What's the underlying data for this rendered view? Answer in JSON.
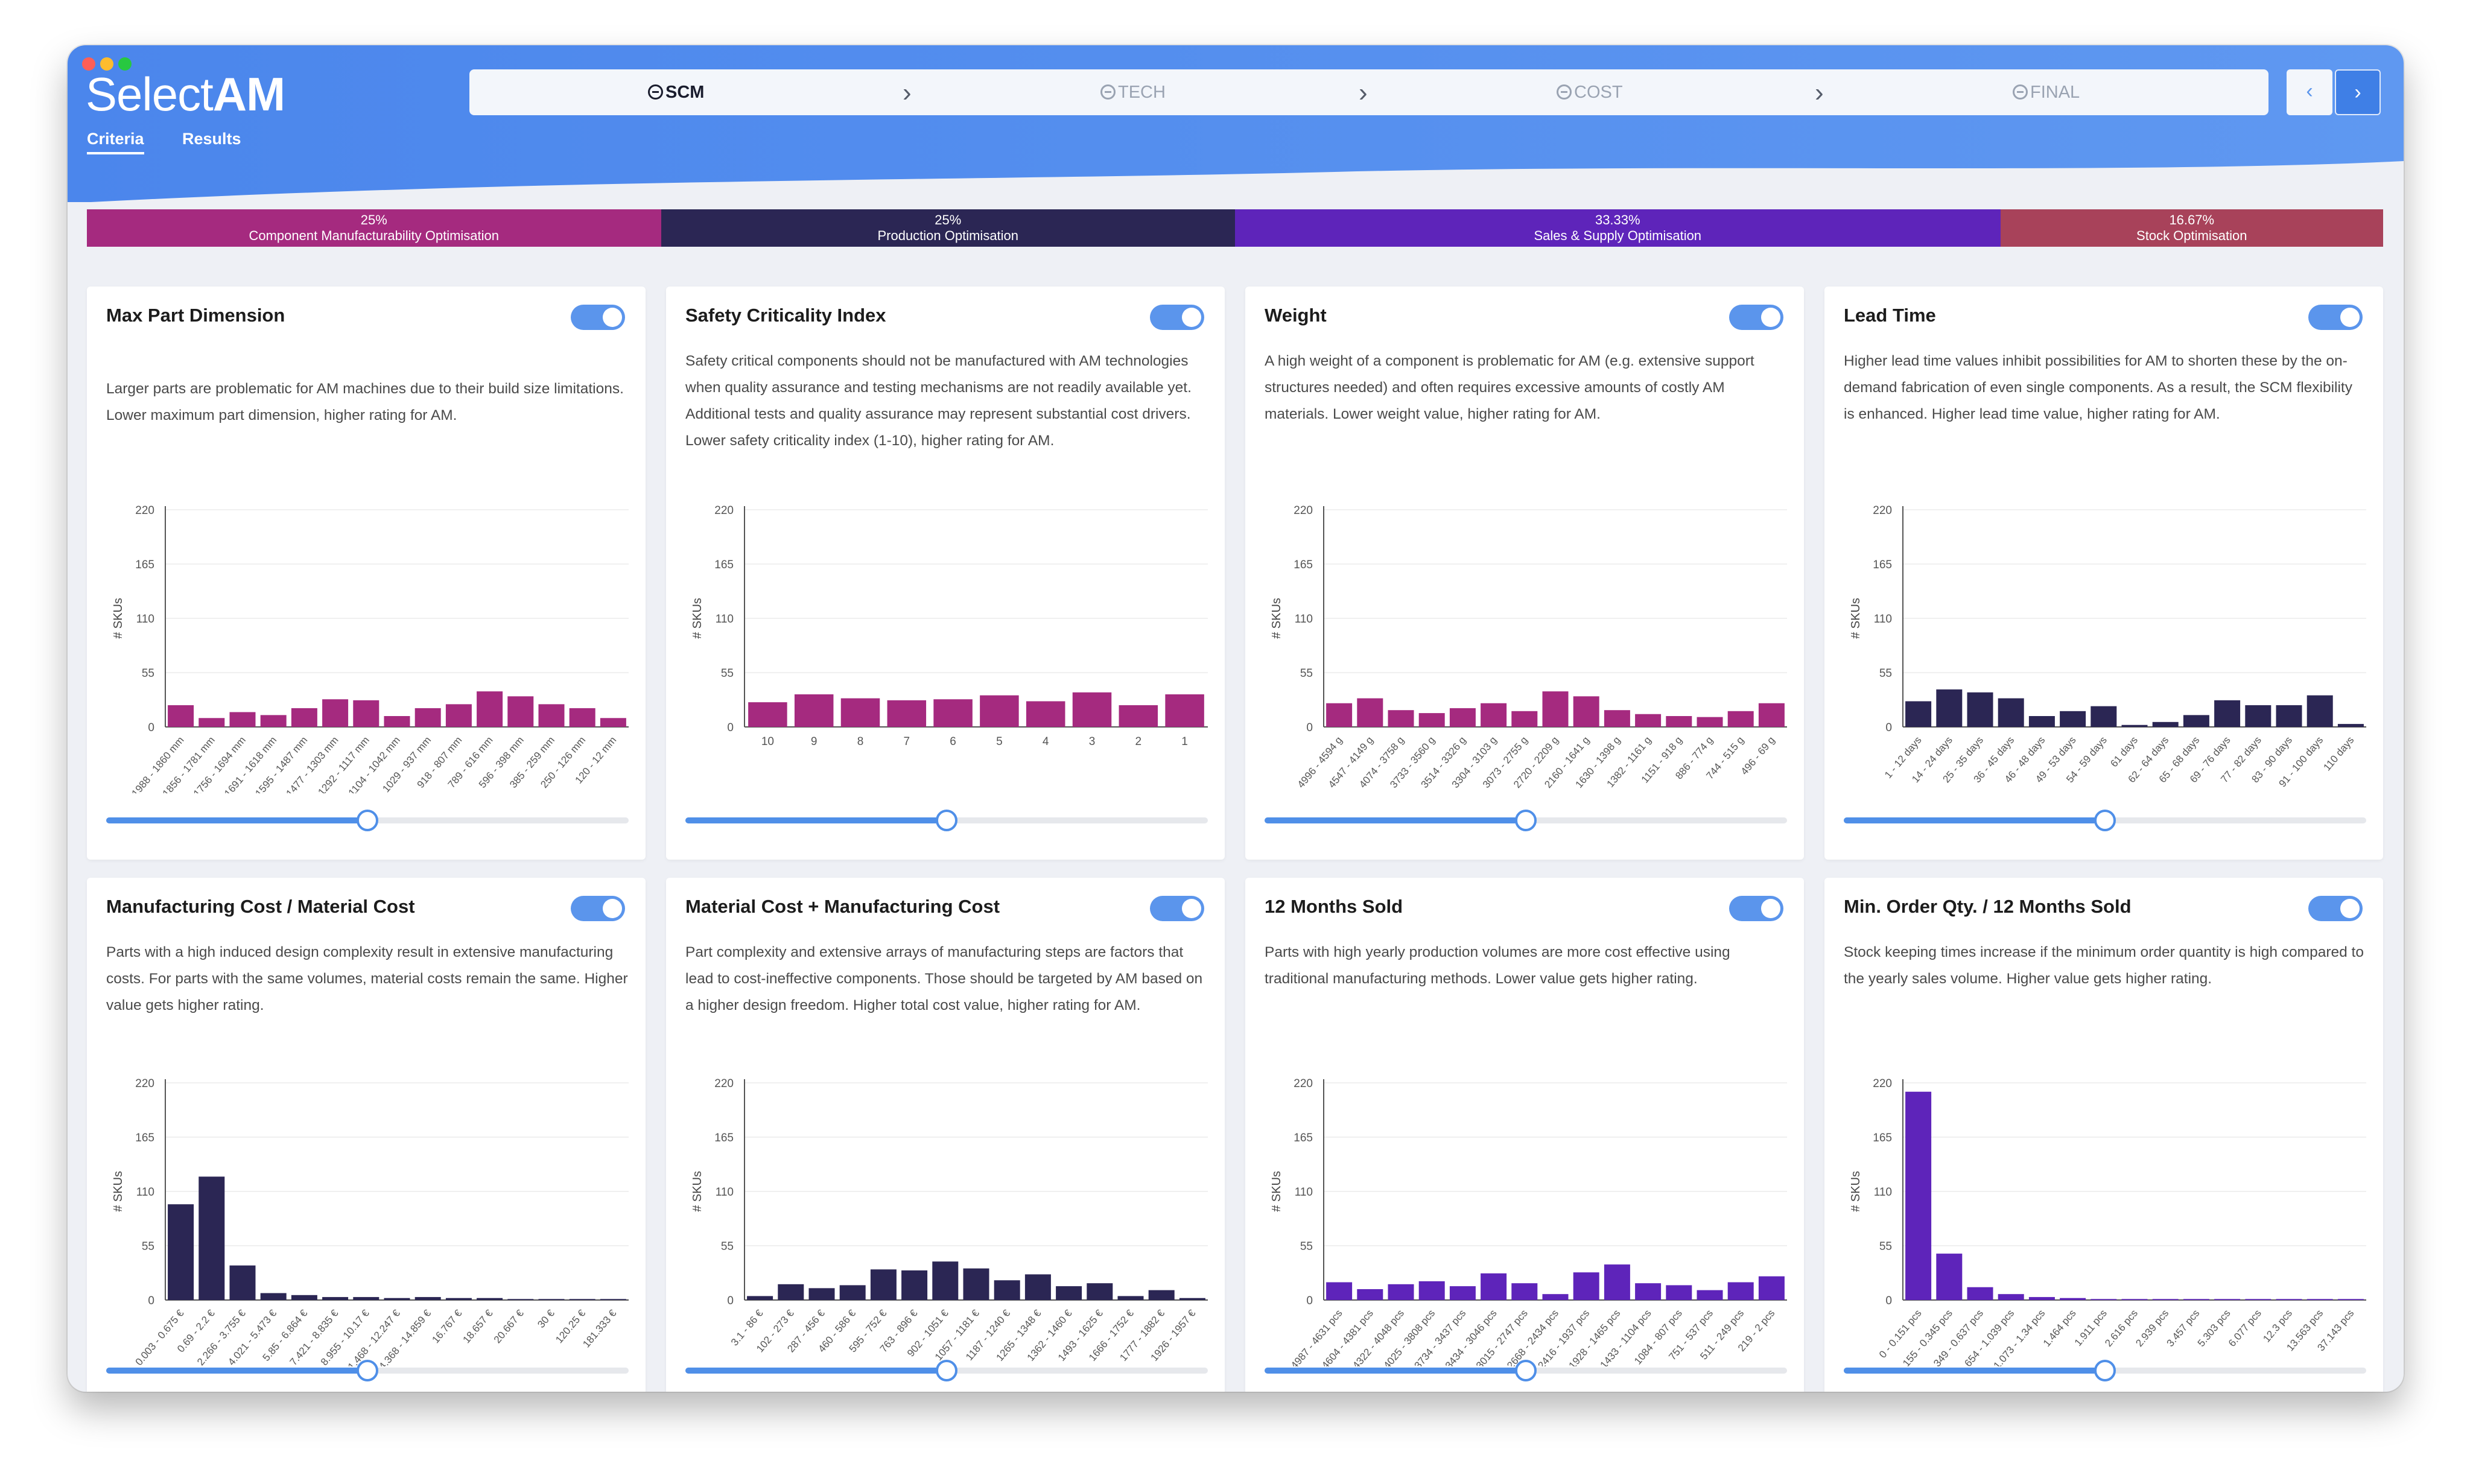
{
  "app": {
    "logo_light": "Select",
    "logo_bold": "AM"
  },
  "nav_tabs": [
    {
      "label": "Criteria",
      "active": true
    },
    {
      "label": "Results",
      "active": false
    }
  ],
  "steps": [
    {
      "label": "SCM",
      "active": true
    },
    {
      "label": "TECH",
      "active": false
    },
    {
      "label": "COST",
      "active": false
    },
    {
      "label": "FINAL",
      "active": false
    }
  ],
  "nav_buttons": {
    "prev": "‹",
    "next": "›"
  },
  "weights": [
    {
      "percent": "25%",
      "label": "Component Manufacturability Optimisation",
      "color": "#a52a7f",
      "share": 0.25
    },
    {
      "percent": "25%",
      "label": "Production Optimisation",
      "color": "#2b2654",
      "share": 0.25
    },
    {
      "percent": "33.33%",
      "label": "Sales & Supply Optimisation",
      "color": "#5e24ba",
      "share": 0.3333
    },
    {
      "percent": "16.67%",
      "label": "Stock Optimisation",
      "color": "#a8425a",
      "share": 0.1667
    }
  ],
  "cards": [
    {
      "title": "Max Part Dimension",
      "enabled": true,
      "description": "Larger parts are problematic for AM machines due to their build size limitations. Lower maximum part dimension, higher rating for AM.",
      "slider": 0.5,
      "chart_data": {
        "type": "bar",
        "ylabel": "# SKUs",
        "yticks": [
          "220",
          "165",
          "110",
          "55",
          "0"
        ],
        "ylim": [
          0,
          220
        ],
        "color": "#a52a7f",
        "categories": [
          "1988 - 1860 mm",
          "1856 - 1781 mm",
          "1756 - 1694 mm",
          "1691 - 1618 mm",
          "1595 - 1487 mm",
          "1477 - 1303 mm",
          "1292 - 1117 mm",
          "1104 - 1042 mm",
          "1029 - 937 mm",
          "918 - 807 mm",
          "789 - 616 mm",
          "596 - 398 mm",
          "385 - 259 mm",
          "250 - 126 mm",
          "120 - 12 mm"
        ],
        "values": [
          22,
          9,
          15,
          12,
          19,
          28,
          27,
          11,
          19,
          23,
          36,
          31,
          23,
          19,
          9
        ]
      }
    },
    {
      "title": "Safety Criticality Index",
      "enabled": true,
      "description": "Safety critical components should not be manufactured with AM technologies when quality assurance and testing mechanisms are not readily available yet. Additional tests and quality assurance may represent substantial cost drivers. Lower safety criticality index (1-10), higher rating for AM.",
      "slider": 0.5,
      "chart_data": {
        "type": "bar",
        "ylabel": "# SKUs",
        "yticks": [
          "220",
          "165",
          "110",
          "55",
          "0"
        ],
        "ylim": [
          0,
          220
        ],
        "color": "#a52a7f",
        "categories": [
          "10",
          "9",
          "8",
          "7",
          "6",
          "5",
          "4",
          "3",
          "2",
          "1"
        ],
        "values": [
          25,
          33,
          29,
          27,
          28,
          32,
          26,
          35,
          22,
          33
        ]
      }
    },
    {
      "title": "Weight",
      "enabled": true,
      "description": "A high weight of a component is problematic for AM (e.g. extensive support structures needed) and often requires excessive amounts of costly AM materials. Lower weight value, higher rating for AM.",
      "slider": 0.5,
      "chart_data": {
        "type": "bar",
        "ylabel": "# SKUs",
        "yticks": [
          "220",
          "165",
          "110",
          "55",
          "0"
        ],
        "ylim": [
          0,
          220
        ],
        "color": "#a52a7f",
        "categories": [
          "4996 - 4594 g",
          "4547 - 4149 g",
          "4074 - 3758 g",
          "3733 - 3560 g",
          "3514 - 3326 g",
          "3304 - 3103 g",
          "3073 - 2755 g",
          "2720 - 2209 g",
          "2160 - 1641 g",
          "1630 - 1398 g",
          "1382 - 1161 g",
          "1151 - 918 g",
          "886 - 774 g",
          "744 - 515 g",
          "496 - 69 g"
        ],
        "values": [
          24,
          29,
          17,
          14,
          19,
          24,
          16,
          36,
          31,
          17,
          13,
          11,
          10,
          16,
          24
        ]
      }
    },
    {
      "title": "Lead Time",
      "enabled": true,
      "description": "Higher lead time values inhibit possibilities for AM to shorten these by the on-demand fabrication of even single components. As a result, the SCM flexibility is enhanced. Higher lead time value, higher rating for AM.",
      "slider": 0.5,
      "chart_data": {
        "type": "bar",
        "ylabel": "# SKUs",
        "yticks": [
          "220",
          "165",
          "110",
          "55",
          "0"
        ],
        "ylim": [
          0,
          220
        ],
        "color": "#2b2654",
        "categories": [
          "1 - 12 days",
          "14 - 24 days",
          "25 - 35 days",
          "36 - 45 days",
          "46 - 48 days",
          "49 - 53 days",
          "54 - 59 days",
          "61 days",
          "62 - 64 days",
          "65 - 68 days",
          "69 - 76 days",
          "77 - 82 days",
          "83 - 90 days",
          "91 - 100 days",
          "110 days"
        ],
        "values": [
          26,
          38,
          35,
          29,
          11,
          16,
          21,
          2,
          5,
          12,
          27,
          22,
          22,
          32,
          3
        ]
      }
    },
    {
      "title": "Manufacturing Cost / Material Cost",
      "enabled": true,
      "description": "Parts with a high induced design complexity result in extensive manufacturing costs. For parts with the same volumes, material costs remain the same. Higher value gets higher rating.",
      "slider": 0.5,
      "chart_data": {
        "type": "bar",
        "ylabel": "# SKUs",
        "yticks": [
          "220",
          "165",
          "110",
          "55",
          "0"
        ],
        "ylim": [
          0,
          220
        ],
        "color": "#2b2654",
        "categories": [
          "0.003 - 0.675 €",
          "0.69 - 2.2 €",
          "2.266 - 3.755 €",
          "4.021 - 5.473 €",
          "5.85 - 6.864 €",
          "7.421 - 8.835 €",
          "8.955 - 10.17 €",
          "11.468 - 12.247 €",
          "14.368 - 14.859 €",
          "16.767 €",
          "18.657 €",
          "20.667 €",
          "30 €",
          "120.25 €",
          "181.333 €"
        ],
        "values": [
          97,
          125,
          35,
          7,
          5,
          3,
          3,
          2,
          3,
          2,
          2,
          1,
          1,
          1,
          1
        ]
      }
    },
    {
      "title": "Material Cost + Manufacturing Cost",
      "enabled": true,
      "description": "Part complexity and extensive arrays of manufacturing steps are factors that lead to cost-ineffective components. Those should be targeted by AM based on a higher design freedom. Higher total cost value, higher rating for AM.",
      "slider": 0.5,
      "chart_data": {
        "type": "bar",
        "ylabel": "# SKUs",
        "yticks": [
          "220",
          "165",
          "110",
          "55",
          "0"
        ],
        "ylim": [
          0,
          220
        ],
        "color": "#2b2654",
        "categories": [
          "3.1 - 86 €",
          "102 - 273 €",
          "287 - 456 €",
          "460 - 586 €",
          "595 - 752 €",
          "763 - 896 €",
          "902 - 1051 €",
          "1057 - 1181 €",
          "1187 - 1240 €",
          "1265 - 1348 €",
          "1362 - 1460 €",
          "1493 - 1625 €",
          "1666 - 1752 €",
          "1777 - 1882 €",
          "1926 - 1957 €"
        ],
        "values": [
          4,
          16,
          12,
          15,
          31,
          30,
          39,
          32,
          20,
          26,
          14,
          17,
          4,
          10,
          2
        ]
      }
    },
    {
      "title": "12 Months Sold",
      "enabled": true,
      "description": "Parts with high yearly production volumes are more cost effective using traditional manufacturing methods. Lower value gets higher rating.",
      "slider": 0.5,
      "chart_data": {
        "type": "bar",
        "ylabel": "# SKUs",
        "yticks": [
          "220",
          "165",
          "110",
          "55",
          "0"
        ],
        "ylim": [
          0,
          220
        ],
        "color": "#5e24ba",
        "categories": [
          "4987 - 4631 pcs",
          "4604 - 4381 pcs",
          "4322 - 4048 pcs",
          "4025 - 3808 pcs",
          "3734 - 3437 pcs",
          "3434 - 3046 pcs",
          "3015 - 2747 pcs",
          "2668 - 2434 pcs",
          "2416 - 1937 pcs",
          "1928 - 1465 pcs",
          "1433 - 1104 pcs",
          "1084 - 807 pcs",
          "751 - 537 pcs",
          "511 - 249 pcs",
          "219 - 2 pcs"
        ],
        "values": [
          18,
          11,
          16,
          19,
          14,
          27,
          17,
          6,
          28,
          36,
          17,
          15,
          10,
          18,
          24
        ]
      }
    },
    {
      "title": "Min. Order Qty. / 12 Months Sold",
      "enabled": true,
      "description": "Stock keeping times increase if the minimum order quantity is high compared to the yearly sales volume. Higher value gets higher rating.",
      "slider": 0.5,
      "chart_data": {
        "type": "bar",
        "ylabel": "# SKUs",
        "yticks": [
          "220",
          "165",
          "110",
          "55",
          "0"
        ],
        "ylim": [
          0,
          220
        ],
        "color": "#5e24ba",
        "categories": [
          "0 - 0.151 pcs",
          "0.155 - 0.345 pcs",
          "0.349 - 0.637 pcs",
          "0.654 - 1.039 pcs",
          "1.073 - 1.34 pcs",
          "1.464 pcs",
          "1.911 pcs",
          "2.616 pcs",
          "2.939 pcs",
          "3.457 pcs",
          "5.303 pcs",
          "6.077 pcs",
          "12.3 pcs",
          "13.563 pcs",
          "37.143 pcs"
        ],
        "values": [
          211,
          47,
          13,
          6,
          3,
          2,
          1,
          1,
          1,
          1,
          1,
          1,
          1,
          1,
          1
        ]
      }
    }
  ]
}
